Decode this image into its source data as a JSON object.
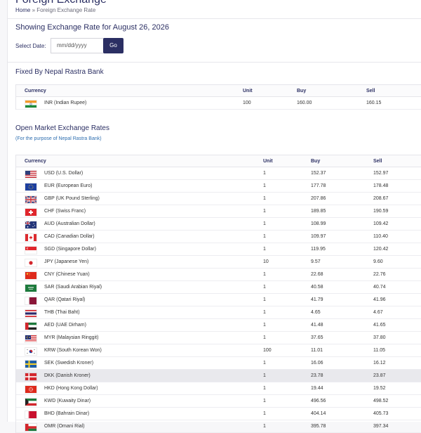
{
  "page": {
    "title_partial": "Foreign Exchange",
    "breadcrumb": {
      "home": "Home",
      "separator": "»",
      "current": "Foreign Exchange Rate"
    }
  },
  "date_filter": {
    "heading": "Showing Exchange Rate for August 26, 2026",
    "label": "Select Date:",
    "placeholder": "mm/dd/yyyy",
    "button": "Go"
  },
  "fixed_section": {
    "title": "Fixed By Nepal Rastra Bank",
    "columns": {
      "currency": "Currency",
      "unit": "Unit",
      "buy": "Buy",
      "sell": "Sell"
    },
    "rows": [
      {
        "flag": "india-flag-icon",
        "currency": "INR (Indian Rupee)",
        "unit": "100",
        "buy": "160.00",
        "sell": "160.15"
      }
    ]
  },
  "open_section": {
    "title": "Open Market Exchange Rates",
    "subtitle": "(For the purpose of Nepal Rastra Bank)",
    "columns": {
      "currency": "Currency",
      "unit": "Unit",
      "buy": "Buy",
      "sell": "Sell"
    },
    "rows": [
      {
        "flag": "usa-flag-icon",
        "currency": "USD (U.S. Dollar)",
        "unit": "1",
        "buy": "152.37",
        "sell": "152.97"
      },
      {
        "flag": "eu-flag-icon",
        "currency": "EUR (European Euro)",
        "unit": "1",
        "buy": "177.78",
        "sell": "178.48"
      },
      {
        "flag": "uk-flag-icon",
        "currency": "GBP (UK Pound Sterling)",
        "unit": "1",
        "buy": "207.86",
        "sell": "208.67"
      },
      {
        "flag": "swiss-flag-icon",
        "currency": "CHF (Swiss Franc)",
        "unit": "1",
        "buy": "189.85",
        "sell": "190.59"
      },
      {
        "flag": "australia-flag-icon",
        "currency": "AUD (Australian Dollar)",
        "unit": "1",
        "buy": "108.99",
        "sell": "109.42"
      },
      {
        "flag": "canada-flag-icon",
        "currency": "CAD (Canadian Dollar)",
        "unit": "1",
        "buy": "109.97",
        "sell": "110.40"
      },
      {
        "flag": "singapore-flag-icon",
        "currency": "SGD (Singapore Dollar)",
        "unit": "1",
        "buy": "119.95",
        "sell": "120.42"
      },
      {
        "flag": "japan-flag-icon",
        "currency": "JPY (Japanese Yen)",
        "unit": "10",
        "buy": "9.57",
        "sell": "9.60"
      },
      {
        "flag": "china-flag-icon",
        "currency": "CNY (Chinese Yuan)",
        "unit": "1",
        "buy": "22.68",
        "sell": "22.76"
      },
      {
        "flag": "saudi-flag-icon",
        "currency": "SAR (Saudi Arabian Riyal)",
        "unit": "1",
        "buy": "40.58",
        "sell": "40.74"
      },
      {
        "flag": "qatar-flag-icon",
        "currency": "QAR (Qatari Riyal)",
        "unit": "1",
        "buy": "41.79",
        "sell": "41.96"
      },
      {
        "flag": "thailand-flag-icon",
        "currency": "THB (Thai Baht)",
        "unit": "1",
        "buy": "4.65",
        "sell": "4.67"
      },
      {
        "flag": "uae-flag-icon",
        "currency": "AED (UAE Dirham)",
        "unit": "1",
        "buy": "41.48",
        "sell": "41.65"
      },
      {
        "flag": "malaysia-flag-icon",
        "currency": "MYR (Malaysian Ringgit)",
        "unit": "1",
        "buy": "37.65",
        "sell": "37.80"
      },
      {
        "flag": "south-korea-flag-icon",
        "currency": "KRW (South Korean Won)",
        "unit": "100",
        "buy": "11.01",
        "sell": "11.05"
      },
      {
        "flag": "sweden-flag-icon",
        "currency": "SEK (Swedish Kroner)",
        "unit": "1",
        "buy": "16.06",
        "sell": "16.12"
      },
      {
        "flag": "denmark-flag-icon",
        "currency": "DKK (Danish Kroner)",
        "unit": "1",
        "buy": "23.78",
        "sell": "23.87",
        "highlighted": true
      },
      {
        "flag": "hong-kong-flag-icon",
        "currency": "HKD (Hong Kong Dollar)",
        "unit": "1",
        "buy": "19.44",
        "sell": "19.52"
      },
      {
        "flag": "kuwait-flag-icon",
        "currency": "KWD (Kuwaity Dinar)",
        "unit": "1",
        "buy": "496.56",
        "sell": "498.52"
      },
      {
        "flag": "bahrain-flag-icon",
        "currency": "BHD (Bahrain Dinar)",
        "unit": "1",
        "buy": "404.14",
        "sell": "405.73"
      },
      {
        "flag": "oman-flag-icon",
        "currency": "OMR (Omani Rial)",
        "unit": "1",
        "buy": "395.78",
        "sell": "397.34"
      }
    ]
  },
  "colors": {
    "brand": "#2b2f63",
    "link": "#2f6fb0",
    "row_highlight": "#e9e9ed"
  }
}
